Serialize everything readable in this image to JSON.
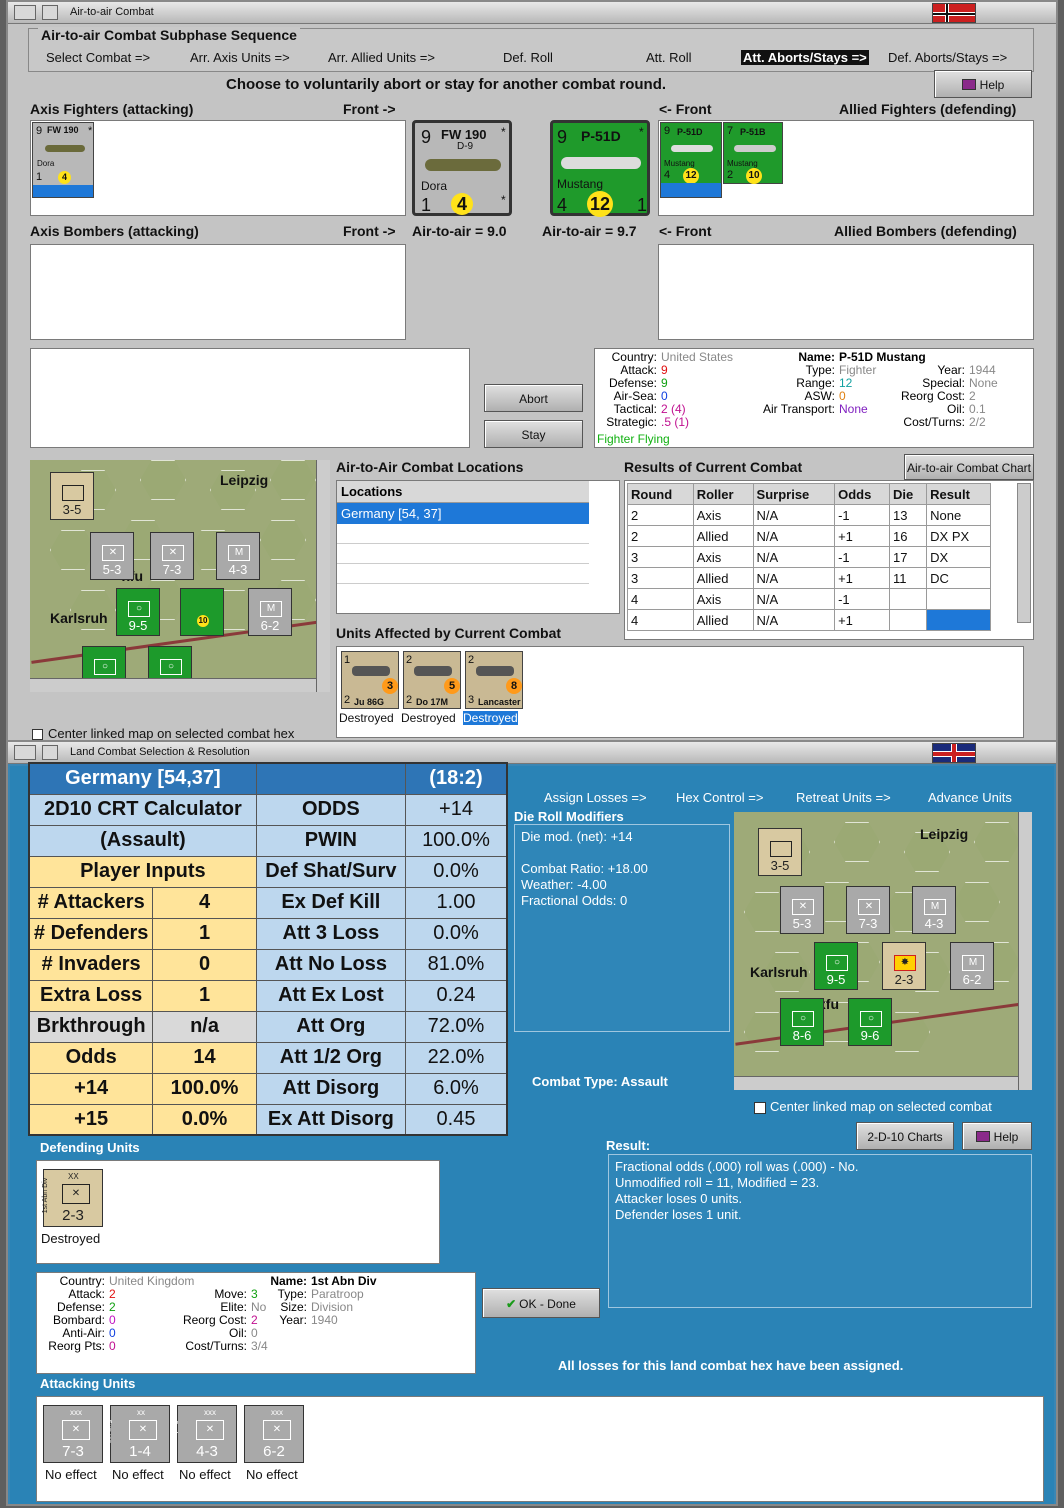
{
  "window1": {
    "title": "Air-to-air Combat"
  },
  "window2": {
    "title": "Land Combat Selection & Resolution"
  },
  "air": {
    "subphase_title": "Air-to-air Combat Subphase Sequence",
    "sequence": [
      "Select Combat =>",
      "Arr. Axis Units =>",
      "Arr. Allied Units =>",
      "Def. Roll",
      "Att. Roll",
      "Att. Aborts/Stays =>",
      "Def. Aborts/Stays =>"
    ],
    "prompt": "Choose to voluntarily abort or stay for another combat round.",
    "help": "Help",
    "axis_fighters": "Axis Fighters (attacking)",
    "front_r": "Front ->",
    "front_l": "<- Front",
    "allied_fighters": "Allied Fighters (defending)",
    "axis_bombers": "Axis Bombers (attacking)",
    "allied_bombers": "Allied Bombers (defending)",
    "a2a_axis": "Air-to-air = 9.0",
    "a2a_allied": "Air-to-air = 9.7",
    "fw": {
      "top": "9",
      "name": "FW 190",
      "sub": "D-9",
      "pilot": "Dora",
      "bl": "1",
      "coin": "4",
      "star": "*"
    },
    "p51": {
      "top": "9",
      "name": "P-51D",
      "pilot": "Mustang",
      "bl": "4",
      "coin": "12",
      "br": "1",
      "star": "*"
    },
    "p51b": {
      "top": "7",
      "name": "P-51B",
      "pilot": "Mustang",
      "bl": "2",
      "coin": "10"
    },
    "abort": "Abort",
    "stay": "Stay",
    "info": {
      "country_l": "Country:",
      "country": "United States",
      "attack_l": "Attack:",
      "attack": "9",
      "defense_l": "Defense:",
      "defense": "9",
      "airsea_l": "Air-Sea:",
      "airsea": "0",
      "tactical_l": "Tactical:",
      "tactical": "2 (4)",
      "strategic_l": "Strategic:",
      "strategic": ".5 (1)",
      "status": "Fighter Flying",
      "name_l": "Name:",
      "name": "P-51D Mustang",
      "type_l": "Type:",
      "type": "Fighter",
      "range_l": "Range:",
      "range": "12",
      "asw_l": "ASW:",
      "asw": "0",
      "transport_l": "Air Transport:",
      "transport": "None",
      "year_l": "Year:",
      "year": "1944",
      "special_l": "Special:",
      "special": "None",
      "reorg_l": "Reorg Cost:",
      "reorg": "2",
      "oil_l": "Oil:",
      "oil": "0.1",
      "cost_l": "Cost/Turns:",
      "cost": "2/2"
    },
    "locations_title": "Air-to-Air Combat Locations",
    "locations_header": "Locations",
    "location_sel": "Germany [54, 37]",
    "results_title": "Results of Current Combat",
    "chart_btn": "Air-to-air Combat Chart",
    "results_headers": [
      "Round",
      "Roller",
      "Surprise",
      "Odds",
      "Die",
      "Result"
    ],
    "results_rows": [
      [
        "2",
        "Axis",
        "N/A",
        "-1",
        "13",
        "None"
      ],
      [
        "2",
        "Allied",
        "N/A",
        "+1",
        "16",
        "DX PX"
      ],
      [
        "3",
        "Axis",
        "N/A",
        "-1",
        "17",
        "DX"
      ],
      [
        "3",
        "Allied",
        "N/A",
        "+1",
        "11",
        "DC"
      ],
      [
        "4",
        "Axis",
        "N/A",
        "-1",
        "",
        ""
      ],
      [
        "4",
        "Allied",
        "N/A",
        "+1",
        "",
        ""
      ]
    ],
    "affected_title": "Units Affected by Current Combat",
    "affected": [
      {
        "name": "Ju 86G",
        "tl": "1",
        "bl": "2",
        "br": "2",
        "coin": "3",
        "status": "Destroyed"
      },
      {
        "name": "Do 17M",
        "tl": "2",
        "bl": "2",
        "br": "2",
        "coin": "5",
        "status": "Destroyed"
      },
      {
        "name": "Lancaster",
        "tl": "2",
        "sub": "Mk. I",
        "bl": "3",
        "br": "7",
        "coin": "8",
        "status": "Destroyed"
      }
    ],
    "center_chk": "Center linked map on selected combat hex"
  },
  "map": {
    "city1": "Leipzig",
    "city2": "Karlsruh",
    "city3": "xfu",
    "units": [
      {
        "t": "5-3",
        "c": "gr"
      },
      {
        "t": "7-3",
        "c": "gr"
      },
      {
        "t": "4-3",
        "c": "gr"
      },
      {
        "t": "9-5",
        "c": "g"
      },
      {
        "t": "6-2",
        "c": "gr"
      },
      {
        "t": "8-6",
        "c": "g"
      },
      {
        "t": "9-6",
        "c": "g"
      },
      {
        "t": "3-5",
        "c": "t"
      }
    ]
  },
  "calc": {
    "title": "Germany [54,37]",
    "ratio": "(18:2)",
    "rows": [
      {
        "a": "2D10 CRT Calculator",
        "b": "",
        "c": "ODDS",
        "d": "+14"
      },
      {
        "a": "(Assault)",
        "b": "",
        "c": "PWIN",
        "d": "100.0%"
      },
      {
        "a": "Player Inputs",
        "b": "",
        "c": "Def Shat/Surv",
        "d": "0.0%"
      },
      {
        "a": "# Attackers",
        "b": "4",
        "c": "Ex Def Kill",
        "d": "1.00"
      },
      {
        "a": "# Defenders",
        "b": "1",
        "c": "Att 3 Loss",
        "d": "0.0%"
      },
      {
        "a": "# Invaders",
        "b": "0",
        "c": "Att No Loss",
        "d": "81.0%"
      },
      {
        "a": "Extra Loss",
        "b": "1",
        "c": "Att Ex Lost",
        "d": "0.24"
      },
      {
        "a": "Brkthrough",
        "b": "n/a",
        "c": "Att Org",
        "d": "72.0%"
      },
      {
        "a": "Odds",
        "b": "14",
        "c": "Att 1/2 Org",
        "d": "22.0%"
      },
      {
        "a": "+14",
        "b": "100.0%",
        "c": "Att Disorg",
        "d": "6.0%"
      },
      {
        "a": "+15",
        "b": "0.0%",
        "c": "Ex Att Disorg",
        "d": "0.45"
      }
    ]
  },
  "land": {
    "sequence": [
      "Assign Losses =>",
      "Hex Control =>",
      "Retreat Units =>",
      "Advance Units"
    ],
    "drm_title": "Die Roll Modifiers",
    "drm_lines": [
      "Die mod. (net): +14",
      "",
      "Combat Ratio: +18.00",
      "Weather: -4.00",
      "Fractional Odds: 0"
    ],
    "combat_type_l": "Combat Type:",
    "combat_type": "Assault",
    "center_chk": "Center linked map on selected combat",
    "charts_btn": "2-D-10 Charts",
    "help": "Help",
    "defending_title": "Defending Units",
    "defender": {
      "top": "XX",
      "side": "1st Abn Div",
      "st": "2-3",
      "status": "Destroyed"
    },
    "result_title": "Result:",
    "result_lines": [
      "Fractional odds (.000) roll was (.000)  - No.",
      "Unmodified roll = 11, Modified = 23.",
      "Attacker loses 0 units.",
      "Defender loses 1 unit."
    ],
    "info": {
      "country_l": "Country:",
      "country": "United Kingdom",
      "attack_l": "Attack:",
      "attack": "2",
      "defense_l": "Defense:",
      "defense": "2",
      "bombard_l": "Bombard:",
      "bombard": "0",
      "aa_l": "Anti-Air:",
      "aa": "0",
      "reorgpts_l": "Reorg Pts:",
      "reorgpts": "0",
      "move_l": "Move:",
      "move": "3",
      "elite_l": "Elite:",
      "elite": "No",
      "reorg_l": "Reorg Cost:",
      "reorg": "2",
      "oil_l": "Oil:",
      "oil": "0",
      "cost_l": "Cost/Turns:",
      "cost": "3/4",
      "name_l": "Name:",
      "name": "1st Abn Div",
      "type_l": "Type:",
      "type": "Paratroop",
      "size_l": "Size:",
      "size": "Division",
      "year_l": "Year:",
      "year": "1940"
    },
    "ok": "OK - Done",
    "all_losses": "All losses for this land combat hex have been assigned.",
    "attacking_title": "Attacking Units",
    "attackers": [
      {
        "side": "XVII Inf",
        "top": "xxx",
        "st": "7-3",
        "status": "No effect"
      },
      {
        "side": "1st Eng",
        "top": "xx",
        "st": "1-4",
        "status": "No effect"
      },
      {
        "side": "Leipzig",
        "top": "xxx",
        "st": "4-3",
        "status": "No effect"
      },
      {
        "side": "Munich",
        "top": "xxx",
        "st": "6-2",
        "status": "No effect"
      }
    ]
  }
}
